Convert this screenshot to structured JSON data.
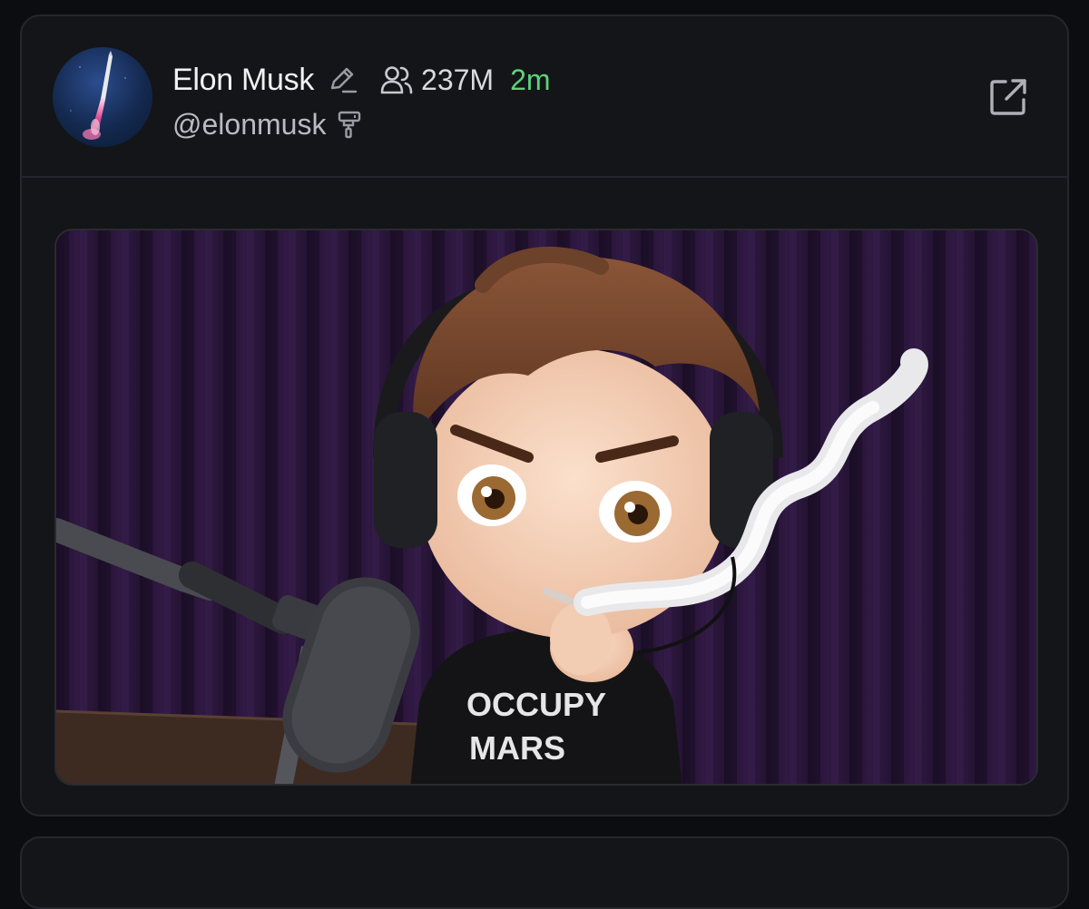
{
  "post": {
    "author_name": "Elon Musk",
    "followers": "237M",
    "time_ago": "2m",
    "handle": "@elonmusk",
    "icons": {
      "edit": "pencil-icon",
      "followers": "people-icon",
      "handle_badge": "paint-roller-icon",
      "open": "external-link-icon"
    },
    "media": {
      "shirt_text_line1": "OCCUPY",
      "shirt_text_line2": "MARS"
    }
  },
  "colors": {
    "background": "#0c0d11",
    "card": "#141518",
    "border": "#26272c",
    "time_green": "#5dd37a"
  }
}
